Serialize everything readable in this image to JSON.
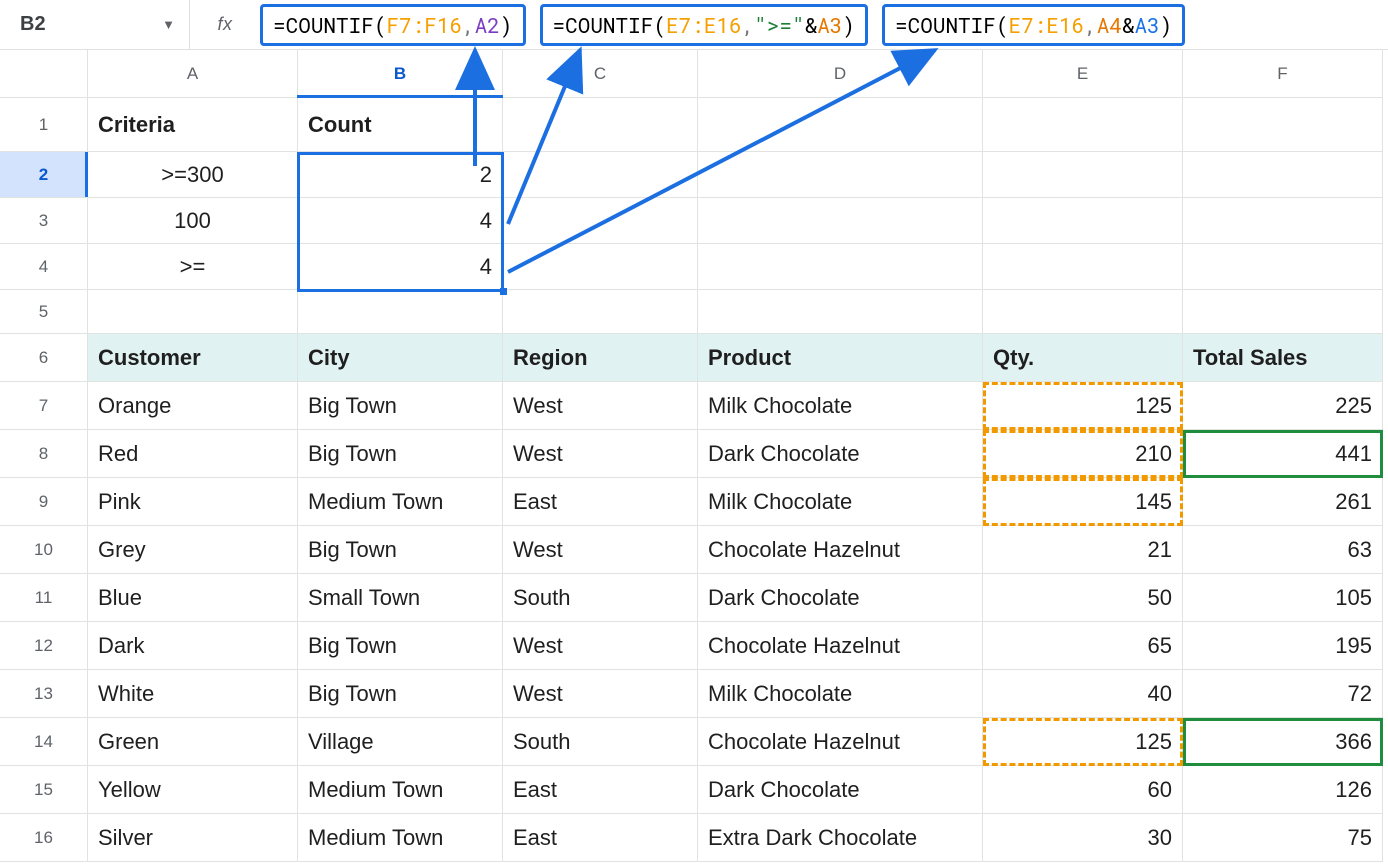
{
  "name_box": "B2",
  "fx": "fx",
  "formulas": {
    "f1": {
      "fn": "COUNTIF",
      "range": "F7:F16",
      "ref": "A2"
    },
    "f2": {
      "fn": "COUNTIF",
      "range": "E7:E16",
      "str": "\">=\"",
      "ref": "A3"
    },
    "f3": {
      "fn": "COUNTIF",
      "range": "E7:E16",
      "ref_a": "A4",
      "ref_b": "A3"
    }
  },
  "col_heads": {
    "A": "A",
    "B": "B",
    "C": "C",
    "D": "D",
    "E": "E",
    "F": "F"
  },
  "row_heads": [
    "1",
    "2",
    "3",
    "4",
    "5",
    "6",
    "7",
    "8",
    "9",
    "10",
    "11",
    "12",
    "13",
    "14",
    "15",
    "16"
  ],
  "top": {
    "A1": "Criteria",
    "B1": "Count",
    "A2": ">=300",
    "B2": "2",
    "A3": "100",
    "B3": "4",
    "A4": ">=",
    "B4": "4"
  },
  "headers": {
    "A": "Customer",
    "B": "City",
    "C": "Region",
    "D": "Product",
    "E": "Qty.",
    "F": "Total Sales"
  },
  "rows": [
    {
      "A": "Orange",
      "B": "Big Town",
      "C": "West",
      "D": "Milk Chocolate",
      "E": "125",
      "F": "225"
    },
    {
      "A": "Red",
      "B": "Big Town",
      "C": "West",
      "D": "Dark Chocolate",
      "E": "210",
      "F": "441"
    },
    {
      "A": "Pink",
      "B": "Medium Town",
      "C": "East",
      "D": "Milk Chocolate",
      "E": "145",
      "F": "261"
    },
    {
      "A": "Grey",
      "B": "Big Town",
      "C": "West",
      "D": "Chocolate Hazelnut",
      "E": "21",
      "F": "63"
    },
    {
      "A": "Blue",
      "B": "Small Town",
      "C": "South",
      "D": "Dark Chocolate",
      "E": "50",
      "F": "105"
    },
    {
      "A": "Dark",
      "B": "Big Town",
      "C": "West",
      "D": "Chocolate Hazelnut",
      "E": "65",
      "F": "195"
    },
    {
      "A": "White",
      "B": "Big Town",
      "C": "West",
      "D": "Milk Chocolate",
      "E": "40",
      "F": "72"
    },
    {
      "A": "Green",
      "B": "Village",
      "C": "South",
      "D": "Chocolate Hazelnut",
      "E": "125",
      "F": "366"
    },
    {
      "A": "Yellow",
      "B": "Medium Town",
      "C": "East",
      "D": "Dark Chocolate",
      "E": "60",
      "F": "126"
    },
    {
      "A": "Silver",
      "B": "Medium Town",
      "C": "East",
      "D": "Extra Dark Chocolate",
      "E": "30",
      "F": "75"
    }
  ]
}
